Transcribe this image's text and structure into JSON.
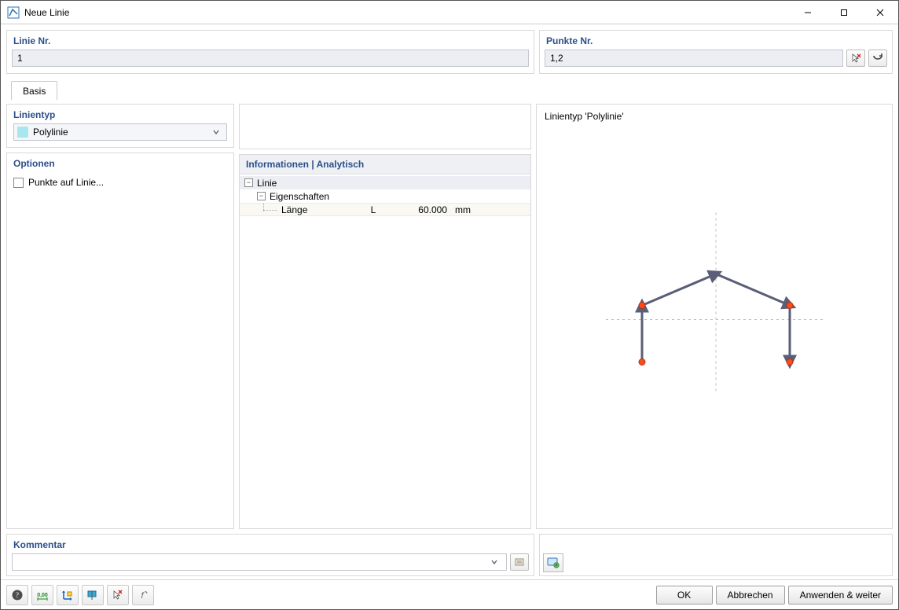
{
  "window": {
    "title": "Neue Linie"
  },
  "lineNo": {
    "label": "Linie Nr.",
    "value": "1"
  },
  "pointsNo": {
    "label": "Punkte Nr.",
    "value": "1,2"
  },
  "tabs": {
    "basis": "Basis"
  },
  "lineType": {
    "label": "Linientyp",
    "selected": "Polylinie"
  },
  "options": {
    "label": "Optionen",
    "pointsOnLine": "Punkte auf Linie..."
  },
  "info": {
    "heading": "Informationen | Analytisch",
    "node_line": "Linie",
    "node_props": "Eigenschaften",
    "prop_length_name": "Länge",
    "prop_length_sym": "L",
    "prop_length_val": "60.000",
    "prop_length_unit": "mm"
  },
  "preview": {
    "label": "Linientyp 'Polylinie'"
  },
  "comment": {
    "label": "Kommentar"
  },
  "buttons": {
    "ok": "OK",
    "cancel": "Abbrechen",
    "applyNext": "Anwenden & weiter"
  }
}
